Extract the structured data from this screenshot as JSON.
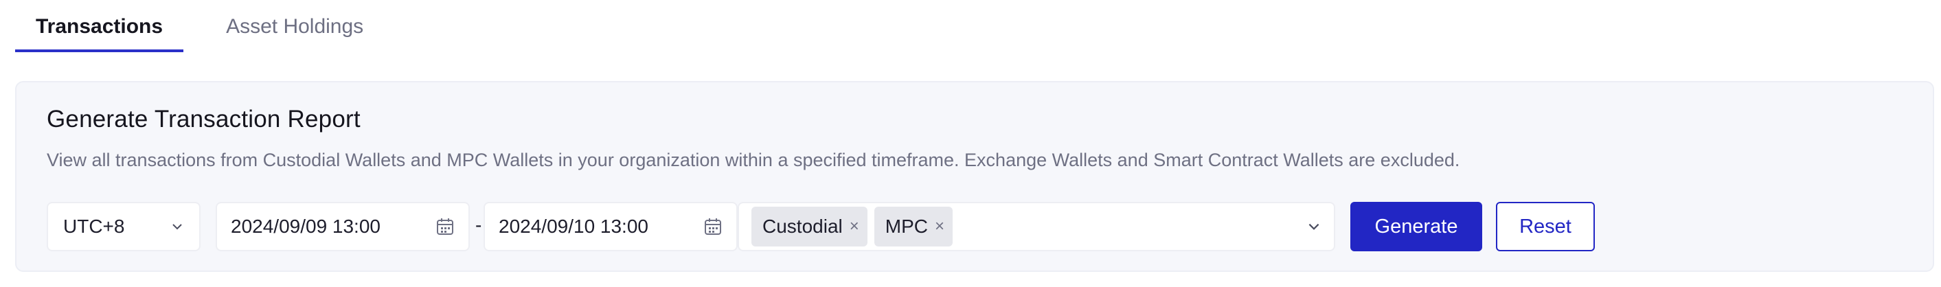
{
  "tabs": [
    {
      "label": "Transactions",
      "active": true
    },
    {
      "label": "Asset Holdings",
      "active": false
    }
  ],
  "report": {
    "title": "Generate Transaction Report",
    "description": "View all transactions from Custodial Wallets and MPC Wallets in your organization within a specified timeframe. Exchange Wallets and Smart Contract Wallets are excluded."
  },
  "filters": {
    "timezone": "UTC+8",
    "start_date": "2024/09/09 13:00",
    "separator": "-",
    "end_date": "2024/09/10 13:00",
    "wallet_types": [
      "Custodial",
      "MPC"
    ],
    "remove_icon": "×"
  },
  "actions": {
    "generate_label": "Generate",
    "reset_label": "Reset"
  },
  "icons": {
    "chevron": "chevron-down-icon",
    "calendar": "calendar-icon",
    "remove": "close-icon"
  },
  "colors": {
    "accent": "#2226c4",
    "panel_bg": "#f6f7fb",
    "muted_text": "#6e7083",
    "tag_bg": "#e6e7ec"
  }
}
